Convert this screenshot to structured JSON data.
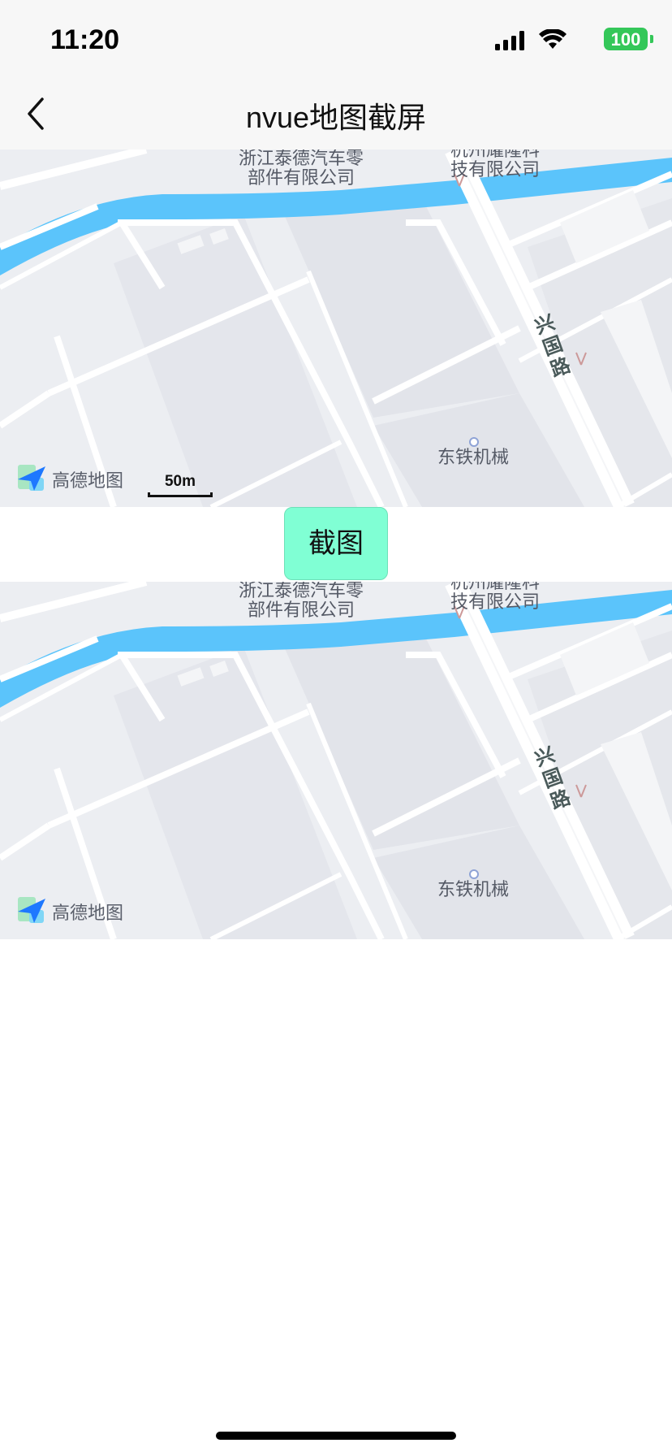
{
  "status_bar": {
    "time": "11:20",
    "battery": "100"
  },
  "nav": {
    "title": "nvue地图截屏"
  },
  "map": {
    "label_company_1_line1": "浙江泰德汽车零",
    "label_company_1_line2": "部件有限公司",
    "label_company_2_line1": "杭州耀隆科",
    "label_company_2_line2": "技有限公司",
    "label_road": "兴国路",
    "label_poi": "东铁机械",
    "logo_text": "高德地图",
    "scale_text": "50m"
  },
  "capture_button": {
    "label": "截图"
  },
  "colors": {
    "river": "#5bc4fb",
    "button": "#80ffd4",
    "battery": "#34c759"
  }
}
